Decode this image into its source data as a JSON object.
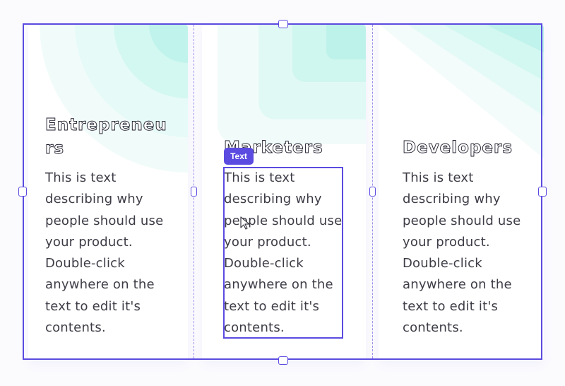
{
  "columns": [
    {
      "heading": "Entrepreneurs",
      "text": "This is text describing why people should use your product. Double-click anywhere on the text to edit it's contents."
    },
    {
      "heading": "Marketers",
      "text": "This is text describing why people should use your product. Double-click anywhere on the text to edit it's contents."
    },
    {
      "heading": "Developers",
      "text": "This is text describing why people should use your product. Double-click anywhere on the text to edit it's contents."
    }
  ],
  "selection": {
    "label": "Text"
  },
  "colors": {
    "accent": "#5b4be0",
    "decoration": "#b9f2ea",
    "text": "#3d3d47"
  },
  "icons": [
    "pointer-cursor-icon"
  ]
}
